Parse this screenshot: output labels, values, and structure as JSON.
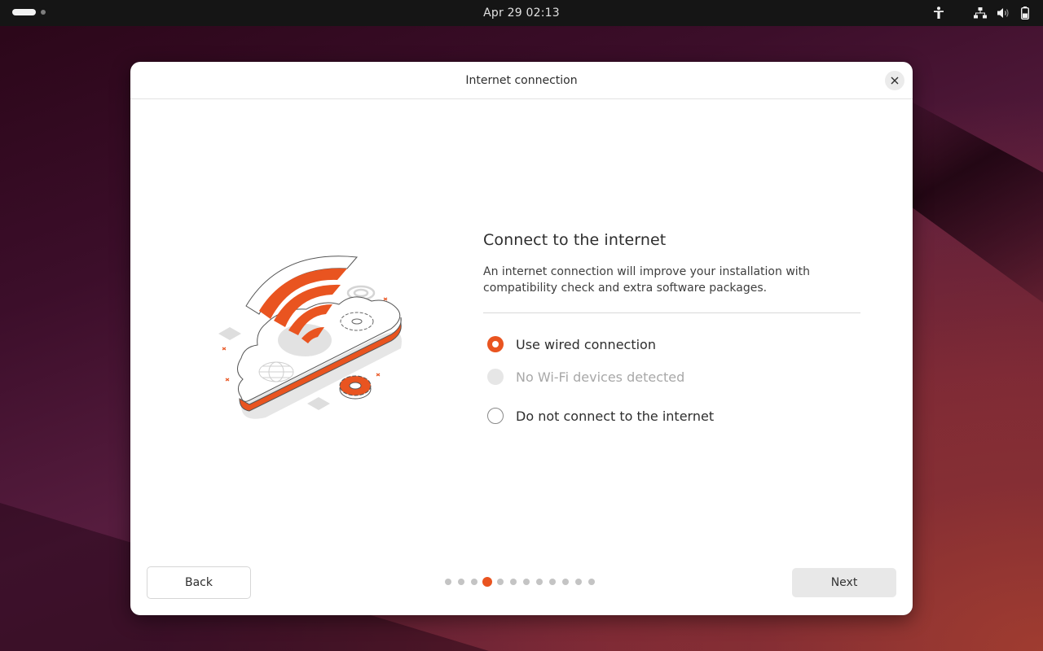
{
  "topbar": {
    "clock": "Apr 29  02:13",
    "workspaces": {
      "count": 2,
      "active_index": 0
    },
    "tray_icons": [
      "accessibility-icon",
      "network-wired-icon",
      "volume-icon",
      "battery-icon"
    ]
  },
  "dialog": {
    "title": "Internet connection",
    "close_icon": "close-icon",
    "heading": "Connect to the internet",
    "description": "An internet connection will improve your installation with compatibility check and extra software packages.",
    "options": [
      {
        "label": "Use wired connection",
        "state": "checked"
      },
      {
        "label": "No Wi-Fi devices detected",
        "state": "disabled"
      },
      {
        "label": "Do not connect to the internet",
        "state": "unchecked"
      }
    ],
    "illustration": "wifi-cloud-illustration",
    "back_label": "Back",
    "next_label": "Next",
    "progress": {
      "total_steps": 12,
      "current_step": 4
    }
  },
  "colors": {
    "accent": "#e95420",
    "topbar_bg": "#151515",
    "dialog_bg": "#ffffff",
    "next_button_bg": "#e8e8e8",
    "pager_inactive": "#c4c4c4"
  }
}
